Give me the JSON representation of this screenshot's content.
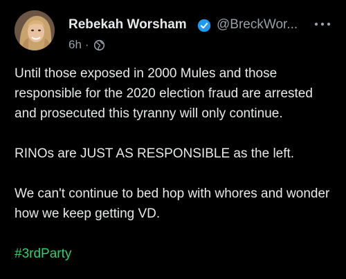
{
  "author": {
    "name": "Rebekah Worsham",
    "handle": "@BreckWor...",
    "verified_color": "#1d9bf0"
  },
  "meta": {
    "time": "6h",
    "separator": "·",
    "audience_icon": "globe-icon"
  },
  "post": {
    "paragraphs": [
      "Until those exposed in 2000 Mules and those responsible for the 2020 election fraud are arrested and prosecuted this tyranny will only continue.",
      "RINOs are JUST AS RESPONSIBLE as the left.",
      "We can't continue to bed hop with whores and wonder how we keep getting VD."
    ],
    "hashtag": "#3rdParty",
    "hashtag_color": "#2ecf6f"
  },
  "colors": {
    "background": "#000000",
    "text": "#e7e9ea",
    "muted": "#9aa0a6"
  }
}
